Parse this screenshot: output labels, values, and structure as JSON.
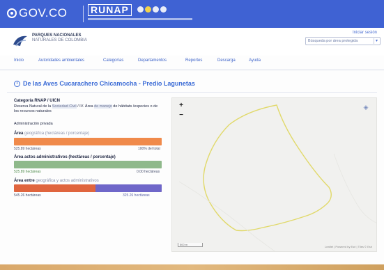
{
  "topbar": {
    "gov_logo": "GOV.CO",
    "app_name": "RUNAP",
    "brand_color": "#3f62d3"
  },
  "header": {
    "org_line1": "PARQUES NACIONALES",
    "org_line2": "NATURALES DE COLOMBIA",
    "login_label": "Iniciar sesión",
    "search_placeholder": "Búsqueda por área protegida"
  },
  "nav": {
    "items": [
      {
        "label": "Inicio"
      },
      {
        "label": "Autoridades ambientales"
      },
      {
        "label": "Categorías"
      },
      {
        "label": "Departamentos"
      },
      {
        "label": "Reportes"
      },
      {
        "label": "Descarga"
      },
      {
        "label": "Ayuda"
      }
    ]
  },
  "page": {
    "title": "De las Aves Cucarachero Chicamocha - Predio Lagunetas",
    "category": "Categoría RNAP / UICN",
    "description_a": "Reserva Natural de la",
    "description_hl1": "Sociedad Civil",
    "description_b": "/ IV. Área",
    "description_hl2": "de manejo",
    "description_c": "de hábitats",
    "description_line2": "/especies o de los recursos naturales",
    "administration": "Administración privada",
    "sections": [
      {
        "label_a": "Área",
        "label_faint": "geográfica (hectáreas / porcentaje)",
        "value_left": "525.89 hectáreas",
        "value_right": "100% del total",
        "fraction": 1.0
      },
      {
        "label": "Área actos administrativos (hectáreas / porcentaje)",
        "value_left": "525.89 hectáreas",
        "value_right": "0.00 hectáreas",
        "fraction": 1.0
      },
      {
        "label_a": "Área entre",
        "label_faint": "geográfica y actos administrativos",
        "value_left": "545.26 hectáreas",
        "value_right": "325.26 hectáreas",
        "fraction_primary": 0.55
      }
    ]
  },
  "map": {
    "zoom_in": "+",
    "zoom_out": "−",
    "scale_label": "500 m",
    "attribution": "Leaflet | Powered by Esri | Tiles © Esri",
    "boundary_color": "#e1d96a"
  }
}
